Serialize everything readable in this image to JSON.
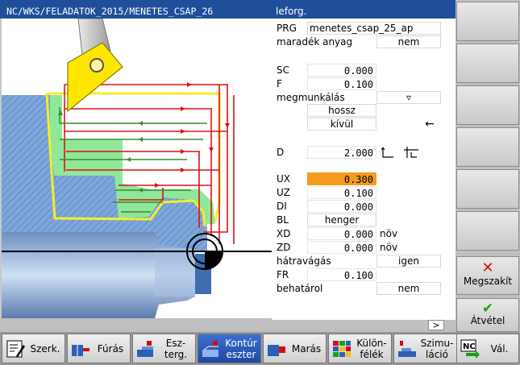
{
  "header": {
    "path": "NC/WKS/FELADATOK_2015/MENETES_CSAP_26",
    "mode": "leforg."
  },
  "params": {
    "prg": {
      "label": "PRG",
      "value": "menetes_csap_25_ap"
    },
    "maradek": {
      "label": "maradék anyag",
      "value": "nem"
    },
    "sc": {
      "label": "SC",
      "value": "0.000"
    },
    "f": {
      "label": "F",
      "value": "0.100"
    },
    "megmunkalas": {
      "label": "megmunkálás",
      "value": "▿"
    },
    "hossz": {
      "value": "hossz"
    },
    "kivul": {
      "value": "kívül"
    },
    "arrow": {
      "value": "←"
    },
    "d": {
      "label": "D",
      "value": "2.000"
    },
    "ux": {
      "label": "UX",
      "value": "0.300"
    },
    "uz": {
      "label": "UZ",
      "value": "0.100"
    },
    "di": {
      "label": "DI",
      "value": "0.000"
    },
    "bl": {
      "label": "BL",
      "value": "henger"
    },
    "xd": {
      "label": "XD",
      "value": "0.000",
      "unit": "növ"
    },
    "zd": {
      "label": "ZD",
      "value": "0.000",
      "unit": "növ"
    },
    "hatravagas": {
      "label": "hátravágás",
      "value": "igen"
    },
    "fr": {
      "label": "FR",
      "value": "0.100"
    },
    "behatarol": {
      "label": "behatárol",
      "value": "nem"
    }
  },
  "more_label": ">",
  "right_softkeys": {
    "megszakit": "Megszakít",
    "atvetel": "Átvétel"
  },
  "bottom_softkeys": [
    {
      "label": "Szerk."
    },
    {
      "label": "Fúrás"
    },
    {
      "label1": "Esz-",
      "label2": "terg."
    },
    {
      "label1": "Kontúr",
      "label2": "eszter"
    },
    {
      "label": "Marás"
    },
    {
      "label1": "Külön-",
      "label2": "félék"
    },
    {
      "label1": "Szimu-",
      "label2": "láció"
    },
    {
      "label": "Vál."
    }
  ],
  "colors": {
    "header_bg": "#1f4f9a",
    "highlight": "#f59c1e",
    "active_softkey": "#2457b8",
    "toolpath_red": "#e01010",
    "toolpath_green": "#3a8a2a",
    "contour_green": "#8fe79a",
    "contour_yellow": "#f2ee2a",
    "stock_blue": "#7fa6d9"
  }
}
